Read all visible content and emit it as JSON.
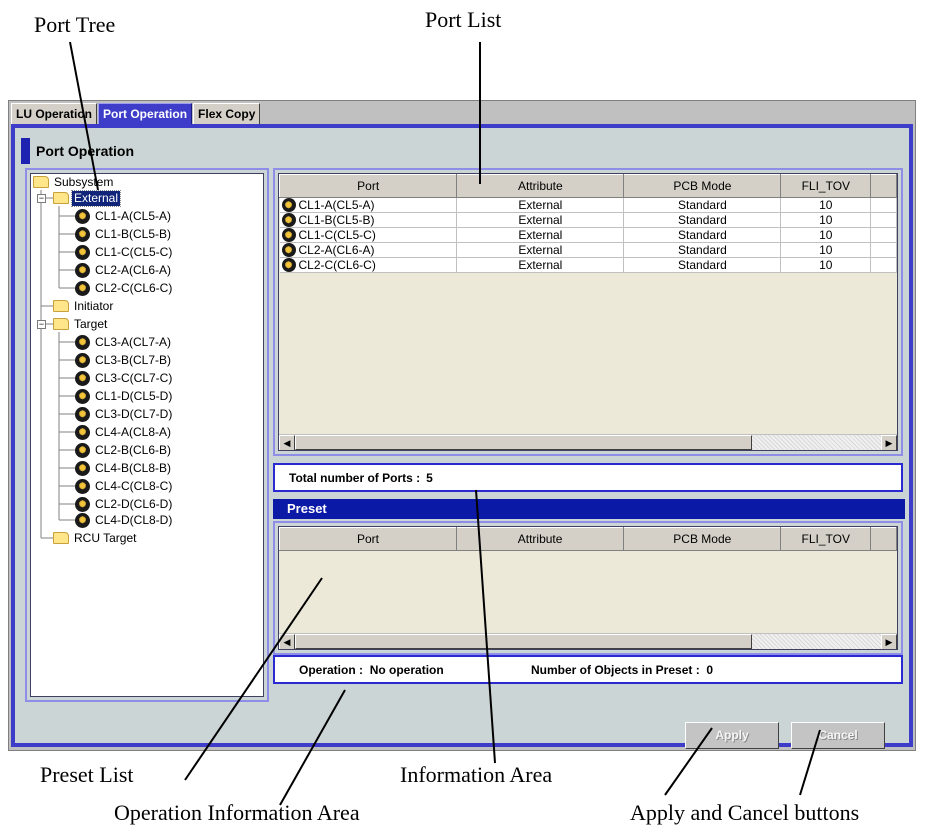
{
  "annotations": {
    "port_tree": "Port Tree",
    "port_list": "Port List",
    "preset_list": "Preset List",
    "information_area": "Information Area",
    "operation_information_area": "Operation Information Area",
    "apply_cancel": "Apply and Cancel buttons"
  },
  "tabs": [
    {
      "label": "LU Operation",
      "active": false
    },
    {
      "label": "Port Operation",
      "active": true
    },
    {
      "label": "Flex Copy",
      "active": false
    }
  ],
  "panel_title": "Port Operation",
  "tree": {
    "root": "Subsystem",
    "external": {
      "label": "External",
      "selected": true,
      "ports": [
        "CL1-A(CL5-A)",
        "CL1-B(CL5-B)",
        "CL1-C(CL5-C)",
        "CL2-A(CL6-A)",
        "CL2-C(CL6-C)"
      ]
    },
    "initiator": "Initiator",
    "target": {
      "label": "Target",
      "ports": [
        "CL3-A(CL7-A)",
        "CL3-B(CL7-B)",
        "CL3-C(CL7-C)",
        "CL1-D(CL5-D)",
        "CL3-D(CL7-D)",
        "CL4-A(CL8-A)",
        "CL2-B(CL6-B)",
        "CL4-B(CL8-B)",
        "CL4-C(CL8-C)",
        "CL2-D(CL6-D)",
        "CL4-D(CL8-D)"
      ]
    },
    "rcu_target": "RCU Target"
  },
  "port_list": {
    "columns": [
      "Port",
      "Attribute",
      "PCB Mode",
      "FLI_TOV"
    ],
    "rows": [
      [
        "CL1-A(CL5-A)",
        "External",
        "Standard",
        "10"
      ],
      [
        "CL1-B(CL5-B)",
        "External",
        "Standard",
        "10"
      ],
      [
        "CL1-C(CL5-C)",
        "External",
        "Standard",
        "10"
      ],
      [
        "CL2-A(CL6-A)",
        "External",
        "Standard",
        "10"
      ],
      [
        "CL2-C(CL6-C)",
        "External",
        "Standard",
        "10"
      ]
    ]
  },
  "info": {
    "label": "Total number of Ports :",
    "value": "5"
  },
  "preset": {
    "title": "Preset",
    "columns": [
      "Port",
      "Attribute",
      "PCB Mode",
      "FLI_TOV"
    ]
  },
  "operation": {
    "op_label": "Operation :",
    "op_value": "No operation",
    "count_label": "Number of Objects in Preset :",
    "count_value": "0"
  },
  "buttons": {
    "apply": "Apply",
    "cancel": "Cancel",
    "enabled": false
  },
  "icons": {
    "folder": "folder-icon",
    "port": "port-icon"
  },
  "colors": {
    "accent": "#3d3dc9",
    "selection": "#10247a",
    "preset_bar": "#0b1aa6"
  }
}
